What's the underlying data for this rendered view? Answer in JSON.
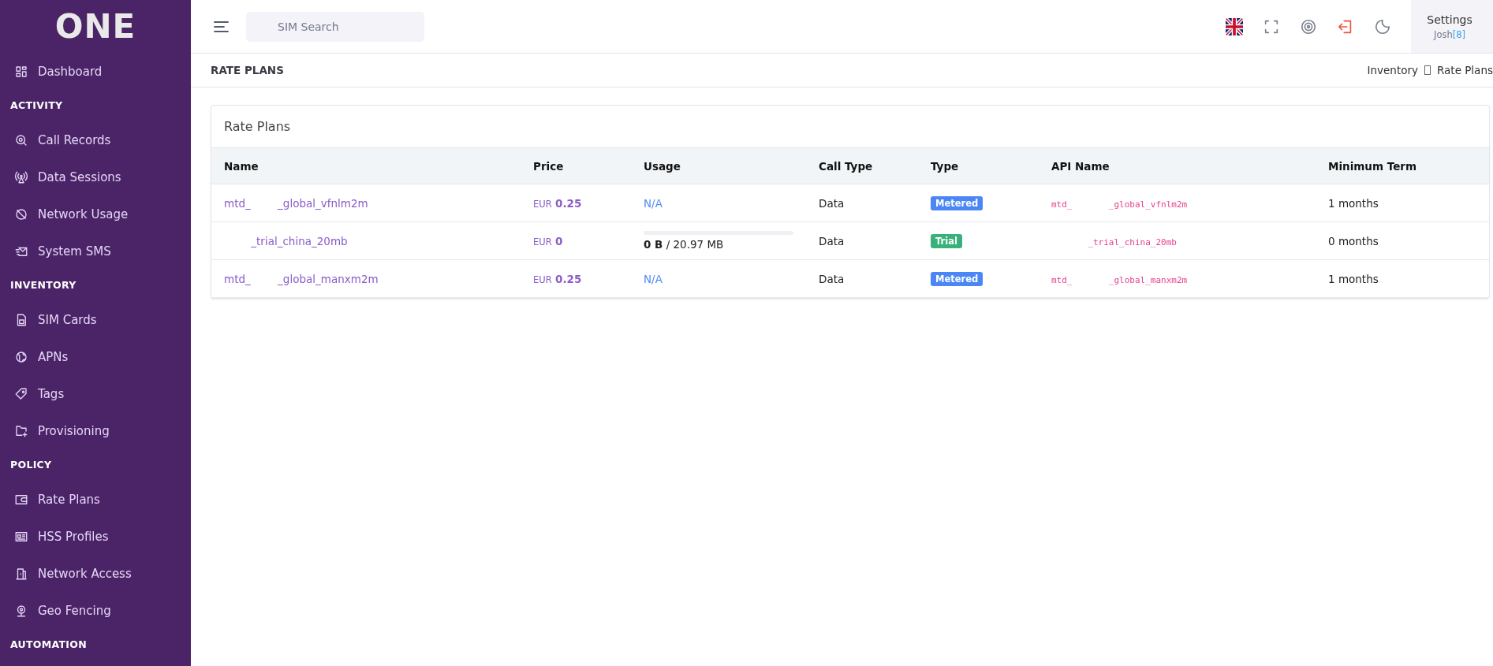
{
  "sidebar": {
    "logo": "ONE",
    "sections": [
      {
        "items": [
          {
            "label": "Dashboard"
          }
        ]
      },
      {
        "heading": "ACTIVITY",
        "items": [
          {
            "label": "Call Records"
          },
          {
            "label": "Data Sessions"
          },
          {
            "label": "Network Usage"
          },
          {
            "label": "System SMS"
          }
        ]
      },
      {
        "heading": "INVENTORY",
        "items": [
          {
            "label": "SIM Cards"
          },
          {
            "label": "APNs"
          },
          {
            "label": "Tags"
          },
          {
            "label": "Provisioning"
          }
        ]
      },
      {
        "heading": "POLICY",
        "items": [
          {
            "label": "Rate Plans"
          },
          {
            "label": "HSS Profiles"
          },
          {
            "label": "Network Access"
          },
          {
            "label": "Geo Fencing"
          }
        ]
      },
      {
        "heading": "AUTOMATION"
      }
    ]
  },
  "topbar": {
    "search": {
      "placeholder": "SIM Search"
    },
    "settings": {
      "label": "Settings",
      "user": "Josh",
      "user_id": "[8]"
    }
  },
  "page_header": {
    "title": "RATE PLANS",
    "breadcrumb": [
      "Inventory",
      "Rate Plans"
    ]
  },
  "card": {
    "title": "Rate Plans",
    "table": {
      "columns": [
        "Name",
        "Price",
        "Usage",
        "Call Type",
        "Type",
        "API Name",
        "Minimum Term"
      ],
      "rows": [
        {
          "name": "mtd_        _global_vfnlm2m",
          "currency": "EUR",
          "price": "0.25",
          "usage": {
            "kind": "na",
            "text": "N/A"
          },
          "call_type": "Data",
          "type": {
            "kind": "metered",
            "label": "Metered"
          },
          "api_name": "mtd_       _global_vfnlm2m",
          "minimum_term": "1 months"
        },
        {
          "name": "        _trial_china_20mb",
          "currency": "EUR",
          "price": "0",
          "usage": {
            "kind": "meter",
            "used": "0 B",
            "total": "/ 20.97 MB",
            "level": 0
          },
          "call_type": "Data",
          "type": {
            "kind": "trial",
            "label": "Trial"
          },
          "api_name": "       _trial_china_20mb",
          "minimum_term": "0 months"
        },
        {
          "name": "mtd_        _global_manxm2m",
          "currency": "EUR",
          "price": "0.25",
          "usage": {
            "kind": "na",
            "text": "N/A"
          },
          "call_type": "Data",
          "type": {
            "kind": "metered",
            "label": "Metered"
          },
          "api_name": "mtd_       _global_manxm2m",
          "minimum_term": "1 months"
        }
      ]
    }
  }
}
